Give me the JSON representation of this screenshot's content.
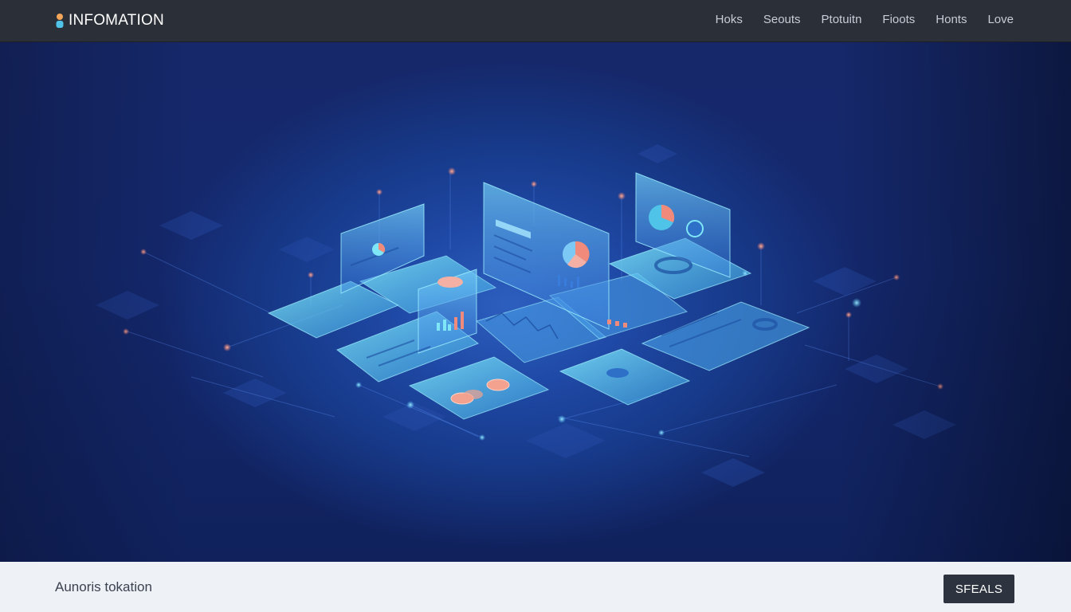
{
  "header": {
    "brand": "INFOMATION",
    "logo_icon": "person-icon",
    "nav": [
      "Hoks",
      "Seouts",
      "Ptotuitn",
      "Fioots",
      "Honts",
      "Love"
    ]
  },
  "footer": {
    "text": "Aunoris tokation",
    "button_label": "SFEALS"
  },
  "colors": {
    "topbar": "#2b2f38",
    "hero": "#1a3a8c",
    "panel": "#5fd6ee",
    "accent": "#f08a7a",
    "footer": "#eef1f6",
    "button": "#2d3440"
  }
}
